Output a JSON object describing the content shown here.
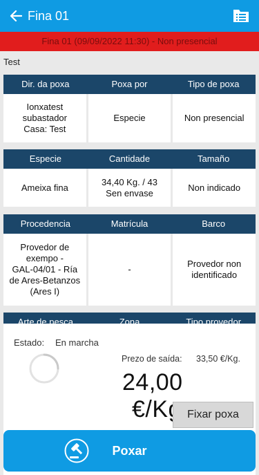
{
  "appbar": {
    "title": "Fina 01"
  },
  "alert": {
    "text": "Fina 01 (09/09/2022 11:30) - Non presencial"
  },
  "subtitle": "Test",
  "table1": {
    "headers": [
      "Dir. da poxa",
      "Poxa por",
      "Tipo de poxa"
    ],
    "cells": [
      "Ionxatest\nsubastador\nCasa: Test",
      "Especie",
      "Non presencial"
    ]
  },
  "table2": {
    "headers": [
      "Especie",
      "Cantidade",
      "Tamaño"
    ],
    "cells": [
      "Ameixa fina",
      "34,40 Kg. / 43\nSen envase",
      "Non indicado"
    ]
  },
  "table3": {
    "headers": [
      "Procedencia",
      "Matrícula",
      "Barco"
    ],
    "cells": [
      "Provedor de\nexempo -\nGAL-04/01 - Ría\nde Ares-Betanzos\n(Ares I)",
      "-",
      "Provedor non\nidentificado"
    ]
  },
  "table4": {
    "headers": [
      "Arte de pesca",
      "Zona",
      "Tipo provedor"
    ]
  },
  "status": {
    "label": "Estado:",
    "value": "En marcha"
  },
  "price": {
    "exit_label": "Prezo de saída:",
    "exit_value": "33,50 €/Kg.",
    "current_number": "24,00",
    "current_unit": "€/Kg."
  },
  "buttons": {
    "fixar": "Fixar poxa",
    "poxar": "Poxar"
  },
  "colors": {
    "appbar": "#0f9be3",
    "alert": "#e11d1d",
    "table_header": "#1b4669"
  },
  "icons": {
    "back": "arrow-left-icon",
    "folder": "folder-list-icon",
    "gavel": "gavel-icon"
  }
}
